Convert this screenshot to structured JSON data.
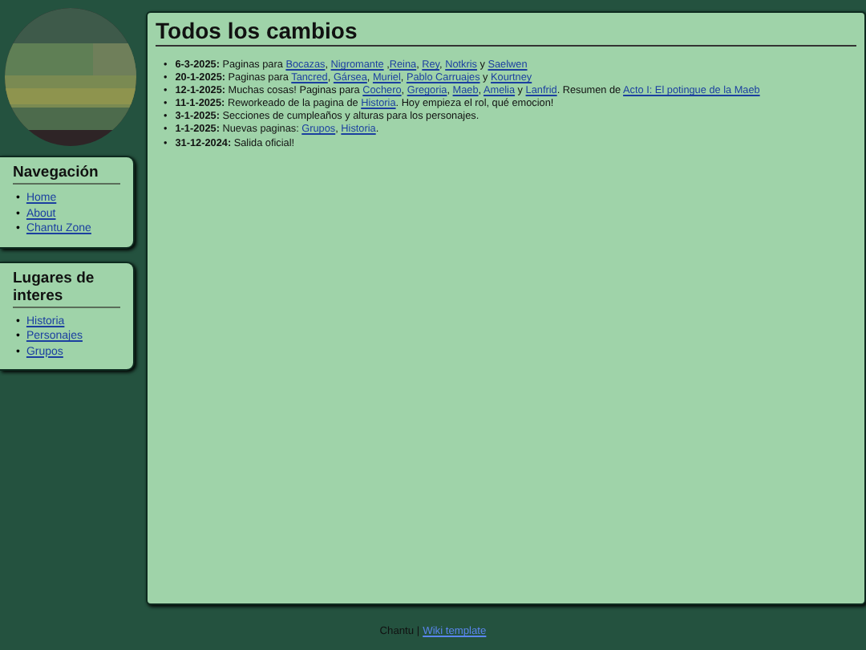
{
  "sidebar": {
    "boxes": [
      {
        "title": "Navegación",
        "marker": "•",
        "links": [
          "Home",
          "About",
          "Chantu Zone"
        ]
      },
      {
        "title": "Lugares de interes",
        "marker": "•",
        "links": [
          "Historia",
          "Personajes",
          "Grupos"
        ]
      }
    ]
  },
  "main": {
    "title": "Todos los cambios",
    "marker": "•",
    "entries": [
      {
        "date": "6-3-2025:",
        "parts": [
          {
            "kind": "text",
            "text": " Paginas para "
          },
          {
            "kind": "link",
            "text": "Bocazas"
          },
          {
            "kind": "text",
            "text": ", "
          },
          {
            "kind": "link",
            "text": "Nigromante"
          },
          {
            "kind": "text",
            "text": " ,"
          },
          {
            "kind": "link",
            "text": "Reina"
          },
          {
            "kind": "text",
            "text": ", "
          },
          {
            "kind": "link",
            "text": "Rey"
          },
          {
            "kind": "text",
            "text": ", "
          },
          {
            "kind": "link",
            "text": "Notkris"
          },
          {
            "kind": "text",
            "text": " y "
          },
          {
            "kind": "link",
            "text": "Saelwen"
          }
        ]
      },
      {
        "date": "20-1-2025:",
        "parts": [
          {
            "kind": "text",
            "text": " Paginas para "
          },
          {
            "kind": "link",
            "text": "Tancred"
          },
          {
            "kind": "text",
            "text": ", "
          },
          {
            "kind": "link",
            "text": "Gársea"
          },
          {
            "kind": "text",
            "text": ", "
          },
          {
            "kind": "link",
            "text": "Muriel"
          },
          {
            "kind": "text",
            "text": ", "
          },
          {
            "kind": "link",
            "text": "Pablo Carruajes"
          },
          {
            "kind": "text",
            "text": " y "
          },
          {
            "kind": "link",
            "text": "Kourtney"
          }
        ]
      },
      {
        "date": "12-1-2025:",
        "parts": [
          {
            "kind": "text",
            "text": " Muchas cosas! Paginas para "
          },
          {
            "kind": "link",
            "text": "Cochero"
          },
          {
            "kind": "text",
            "text": ", "
          },
          {
            "kind": "link",
            "text": "Gregoria"
          },
          {
            "kind": "text",
            "text": ", "
          },
          {
            "kind": "link",
            "text": "Maeb"
          },
          {
            "kind": "text",
            "text": ", "
          },
          {
            "kind": "link",
            "text": "Amelia"
          },
          {
            "kind": "text",
            "text": " y "
          },
          {
            "kind": "link",
            "text": "Lanfrid"
          },
          {
            "kind": "text",
            "text": ". Resumen de "
          },
          {
            "kind": "link",
            "text": "Acto I: El potingue de la Maeb"
          }
        ]
      },
      {
        "date": "11-1-2025:",
        "parts": [
          {
            "kind": "text",
            "text": " Reworkeado de la pagina de "
          },
          {
            "kind": "link",
            "text": "Historia"
          },
          {
            "kind": "text",
            "text": ". Hoy empieza el rol, qué emocion!"
          }
        ]
      },
      {
        "date": "3-1-2025:",
        "parts": [
          {
            "kind": "text",
            "text": " Secciones de cumpleaños y alturas para los personajes."
          }
        ]
      },
      {
        "date": "1-1-2025:",
        "parts": [
          {
            "kind": "text",
            "text": " Nuevas paginas: "
          },
          {
            "kind": "link",
            "text": "Grupos"
          },
          {
            "kind": "text",
            "text": ", "
          },
          {
            "kind": "link",
            "text": "Historia"
          },
          {
            "kind": "text",
            "text": "."
          }
        ]
      },
      {
        "date": "31-12-2024:",
        "parts": [
          {
            "kind": "text",
            "text": " Salida oficial!"
          }
        ]
      }
    ]
  },
  "footer": {
    "text": "Chantu |",
    "link": "Wiki template"
  }
}
